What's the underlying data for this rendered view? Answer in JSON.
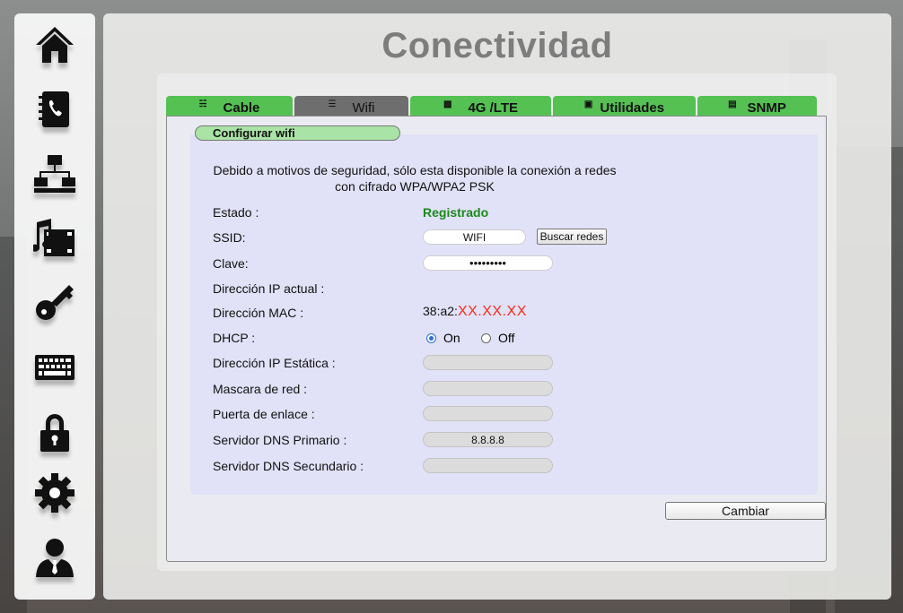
{
  "page": {
    "title": "Conectividad"
  },
  "sidebar": {
    "items": [
      {
        "icon": "home-icon"
      },
      {
        "icon": "phonebook-icon"
      },
      {
        "icon": "network-icon"
      },
      {
        "icon": "multimedia-icon"
      },
      {
        "icon": "key-icon"
      },
      {
        "icon": "keyboard-icon"
      },
      {
        "icon": "lock-icon"
      },
      {
        "icon": "gear-icon"
      },
      {
        "icon": "user-icon"
      }
    ]
  },
  "tabs": [
    {
      "label": "Cable",
      "icon": "ethernet-icon",
      "active": false
    },
    {
      "label": "Wifi",
      "icon": "wifi-icon",
      "active": true
    },
    {
      "label": "4G /LTE",
      "icon": "cellular-icon",
      "active": false
    },
    {
      "label": "Utilidades",
      "icon": "tools-icon",
      "active": false
    },
    {
      "label": "SNMP",
      "icon": "document-icon",
      "active": false
    }
  ],
  "section": {
    "title": "Configurar wifi"
  },
  "notice": {
    "line1": "Debido a motivos de seguridad, sólo esta disponible la conexión a redes",
    "line2": "con cifrado WPA/WPA2 PSK"
  },
  "form": {
    "estado": {
      "label": "Estado :",
      "value": "Registrado"
    },
    "ssid": {
      "label": "SSID:",
      "value": "WIFI",
      "button": "Buscar redes"
    },
    "clave": {
      "label": "Clave:",
      "value": "123456789"
    },
    "ip_actual": {
      "label": "Dirección IP actual :"
    },
    "mac": {
      "label": "Dirección MAC :",
      "prefix": "38:a2:",
      "masked": "XX.XX.XX"
    },
    "dhcp": {
      "label": "DHCP :",
      "on": "On",
      "off": "Off",
      "selected": "On"
    },
    "ip_static": {
      "label": "Dirección IP Estática :",
      "value": ""
    },
    "netmask": {
      "label": "Mascara de red :",
      "value": ""
    },
    "gateway": {
      "label": "Puerta de enlace :",
      "value": ""
    },
    "dns1": {
      "label": "Servidor DNS Primario :",
      "value": "8.8.8.8"
    },
    "dns2": {
      "label": "Servidor DNS Secundario :",
      "value": ""
    }
  },
  "actions": {
    "apply": "Cambiar"
  },
  "colors": {
    "tab_green": "#55c153",
    "tab_active": "#6e6e6e",
    "status_ok": "#1a8a1a",
    "mac_red": "#ff2a1a",
    "pill_green": "#a9e3a5"
  }
}
